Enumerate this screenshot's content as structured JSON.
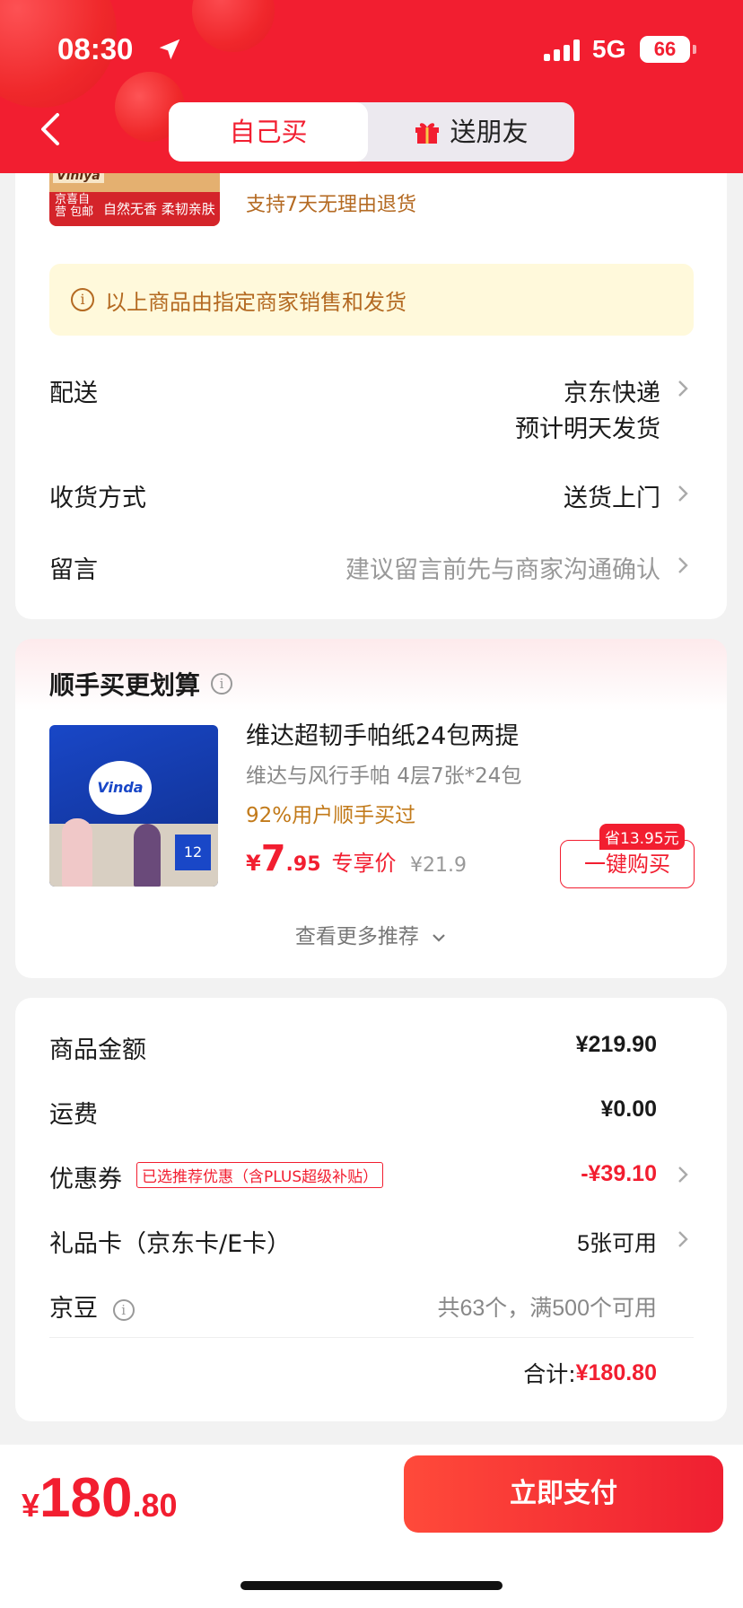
{
  "status_bar": {
    "time": "08:30",
    "network": "5G",
    "battery": "66"
  },
  "tabs": {
    "self_buy": "自己买",
    "gift": "送朋友"
  },
  "product": {
    "brand": "Viniya",
    "thumb_tag": "京喜自营 包邮",
    "thumb_slogan": "自然无香 柔韧亲肤",
    "return_policy": "支持7天无理由退货"
  },
  "notice": "以上商品由指定商家销售和发货",
  "order_rows": [
    {
      "label": "配送",
      "value_line1": "京东快递",
      "value_line2": "预计明天发货"
    },
    {
      "label": "收货方式",
      "value": "送货上门"
    },
    {
      "label": "留言",
      "placeholder": "建议留言前先与商家沟通确认"
    }
  ],
  "recommend": {
    "title": "顺手买更划算",
    "product_title": "维达超韧手帕纸24包两提",
    "product_subtitle": "维达与风行手帕 4层7张*24包",
    "purchase_rate": "92%用户顺手买过",
    "price_currency": "¥",
    "price_int": "7",
    "price_dec": ".95",
    "price_label": "专享价",
    "original_price": "¥21.9",
    "save_badge": "省13.95元",
    "buy_button": "一键购买",
    "more": "查看更多推荐",
    "image_logo": "Vinda",
    "image_pack_count": "12"
  },
  "summary": {
    "goods_amount_label": "商品金额",
    "goods_amount": "¥219.90",
    "shipping_label": "运费",
    "shipping": "¥0.00",
    "coupon_label": "优惠券",
    "coupon_tag": "已选推荐优惠（含PLUS超级补贴）",
    "coupon_value": "-¥39.10",
    "gift_card_label": "礼品卡（京东卡/E卡）",
    "gift_card_value": "5张可用",
    "jd_bean_label": "京豆",
    "jd_bean_value": "共63个，满500个可用",
    "total_label": "合计:",
    "total_value": "¥180.80"
  },
  "bottom_bar": {
    "currency": "¥",
    "int": "180",
    "dec": ".80",
    "pay_button": "立即支付"
  },
  "colors": {
    "accent": "#f21e30",
    "notice_bg": "#fff9db",
    "notice_text": "#b46a22"
  }
}
